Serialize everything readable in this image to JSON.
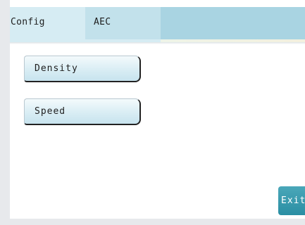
{
  "tabs": [
    {
      "label": "Config",
      "active": true
    },
    {
      "label": "AEC",
      "active": false
    }
  ],
  "buttons": {
    "density_label": "Density",
    "speed_label": "Speed",
    "exit_label": "Exit"
  },
  "colors": {
    "tab_bar": "#a9d4e2",
    "active_tab": "#d6ecf3",
    "inactive_tab": "#c2e1eb",
    "exit_button": "#3a9cb0"
  }
}
